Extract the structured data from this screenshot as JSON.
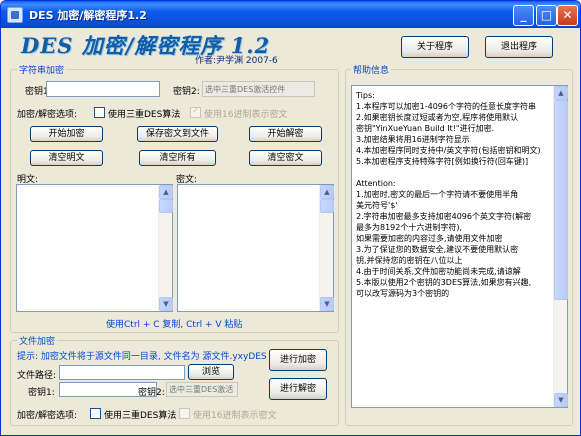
{
  "window": {
    "title": "DES 加密/解密程序1.2",
    "controls": {
      "minimize": "_",
      "maximize": "□",
      "close": "✕"
    }
  },
  "header": {
    "logo": "DES 加密/解密程序 1.2",
    "author": "作者:尹学渊    2007-6",
    "about_button": "关于程序",
    "exit_button": "退出程序"
  },
  "string_encrypt": {
    "group_label": "字符串加密",
    "key1_label": "密钥1:",
    "key1_value": "",
    "key2_label": "密钥2:",
    "key2_placeholder": "选中三重DES激活控件",
    "mode_label": "加密/解密选项:",
    "triple_des_label": "使用三重DES算法",
    "triple_des_checked": false,
    "hex_label": "使用16进制表示密文",
    "hex_checked": true,
    "buttons": {
      "encrypt": "开始加密",
      "save": "保存密文到文件",
      "decrypt": "开始解密",
      "clear_plain": "清空明文",
      "clear_all": "清空所有",
      "clear_cipher": "清空密文"
    },
    "plain_label": "明文:",
    "plain_text": "",
    "cipher_label": "密文:",
    "cipher_text": "",
    "copy_hint": "使用Ctrl + C 复制, Ctrl + V 粘贴"
  },
  "file_encrypt": {
    "group_label": "文件加密",
    "hint": "提示: 加密文件将于源文件同一目录, 文件名为 源文件.yxyDES",
    "path_label": "文件路径:",
    "path_value": "",
    "browse_button": "浏览",
    "key1_label": "密钥1:",
    "key1_value": "",
    "key2_label": "密钥2:",
    "key2_placeholder": "选中三重DES激活",
    "encrypt_button": "进行加密",
    "decrypt_button": "进行解密",
    "mode_label": "加密/解密选项:",
    "triple_des_label": "使用三重DES算法",
    "triple_des_checked": false,
    "hex_label": "使用16进制表示密文",
    "hex_checked": false
  },
  "help": {
    "group_label": "帮助信息",
    "lines": [
      "Tips:",
      "1.本程序可以加密1-4096个字符的任意长度字符串",
      "2.如果密钥长度过短或者为空,程序将使用默认",
      "密钥\"YinXueYuan Build It!\"进行加密.",
      "3.加密结果将用16进制字符显示",
      "4.本加密程序同时支持中/英文字符(包括密钥和明文)",
      "5.本加密程序支持特殊字符[例如换行符(回车键)]",
      "",
      "Attention:",
      "1.加密时,密文的最后一个字符请不要使用半角",
      "美元符号'$'",
      "2.字符串加密最多支持加密4096个英文字符(解密",
      "最多为8192个十六进制字符),",
      "如果需要加密的内容过多,请使用文件加密",
      "3.为了保证您的数据安全,建议不要使用默认密",
      "钥,并保持您的密钥在八位以上",
      "4.由于时间关系,文件加密功能尚未完成,请谅解",
      "5.本版以使用2个密钥的3DES算法,如果您有兴趣,",
      "可以改写源码为3个密钥的"
    ]
  }
}
